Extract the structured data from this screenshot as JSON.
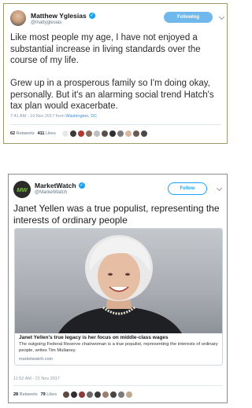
{
  "tweet1": {
    "author_name": "Matthew Yglesias",
    "handle": "@mattyglesias",
    "follow_label": "Following",
    "paragraph1": "Like most people my age, I have not enjoyed a substantial increase in living standards over the course of my life.",
    "paragraph2": "Grew up in a prosperous family so I'm doing okay, personally. But it's an alarming social trend Hatch's tax plan would exacerbate.",
    "timestamp": "7:41 AM - 19 Nov 2017 from",
    "location": "Washington, DC",
    "retweets_count": "62",
    "retweets_label": "Retweets",
    "likes_count": "411",
    "likes_label": "Likes",
    "liker_colors": [
      "#e8e8e8",
      "#3a3a3a",
      "#b03a2e",
      "#8a6d5a",
      "#c0c0c0",
      "#5a4f4a",
      "#2d2d2d",
      "#7a7a7a",
      "#d8b8a0",
      "#6a5a50",
      "#4a4a4a"
    ]
  },
  "tweet2": {
    "author_name": "MarketWatch",
    "handle": "@MarketWatch",
    "avatar_text": "MW",
    "follow_label": "Follow",
    "headline": "Janet Yellen was a true populist, representing the interests of ordinary people",
    "card": {
      "title": "Janet Yellen's true legacy is her focus on middle-class wages",
      "description": "The outgoing Federal Reserve chairwoman is a true populist, representing the interests of ordinary people, writes Tim Mullaney.",
      "url": "marketwatch.com"
    },
    "timestamp": "11:52 AM - 21 Nov 2017",
    "retweets_count": "28",
    "retweets_label": "Retweets",
    "likes_count": "79",
    "likes_label": "Likes",
    "liker_colors": [
      "#5a4a40",
      "#2f2f2f",
      "#8a3a3a",
      "#6a6a6a",
      "#3a3a3a",
      "#9a8070",
      "#454545",
      "#7a7a7a",
      "#c0a890"
    ]
  },
  "colors": {
    "accent": "#1da1f2",
    "following_bg": "#6fb8ec",
    "link": "#3c8fd6"
  }
}
